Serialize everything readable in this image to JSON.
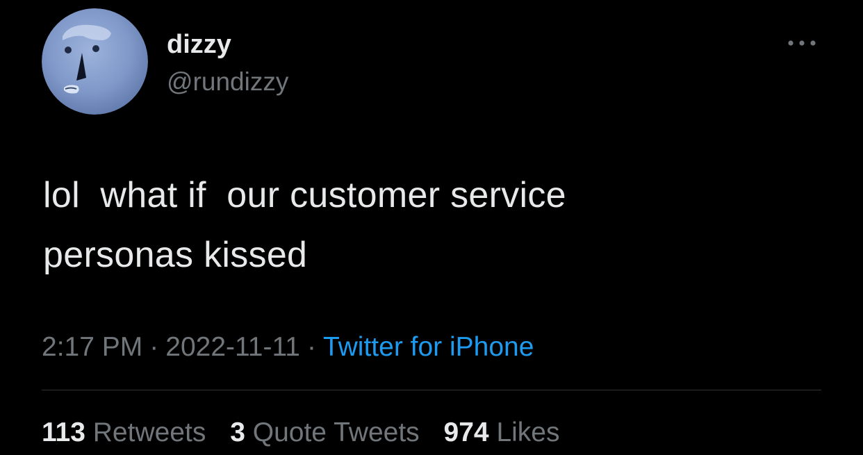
{
  "colors": {
    "background": "#000000",
    "primary_text": "#e7e9ea",
    "secondary_text": "#71767b",
    "link": "#1d9bf0",
    "divider": "#2f3336"
  },
  "author": {
    "display_name": "dizzy",
    "handle": "@rundizzy",
    "avatar_icon": "stone-face-avatar"
  },
  "more_icon": "more-horizontal-icon",
  "tweet": {
    "text": "lol  what if  our customer service\npersonas kissed",
    "time": "2:17 PM",
    "separator": "·",
    "date": "2022-11-11",
    "source": "Twitter for iPhone"
  },
  "stats": {
    "retweets": {
      "count": "113",
      "label": "Retweets"
    },
    "quotes": {
      "count": "3",
      "label": "Quote Tweets"
    },
    "likes": {
      "count": "974",
      "label": "Likes"
    }
  }
}
